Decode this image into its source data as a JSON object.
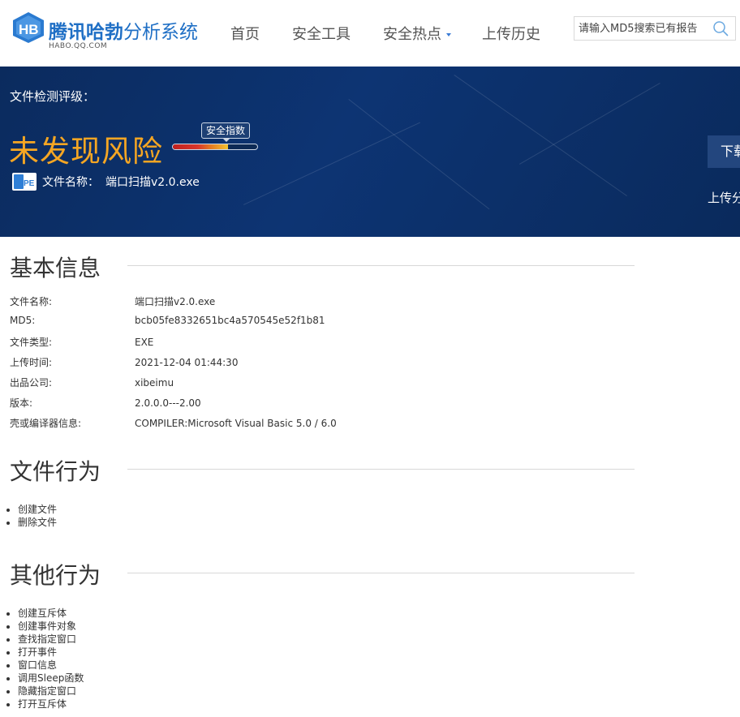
{
  "header": {
    "logo_title_bold": "腾讯哈勃",
    "logo_title_thin": "分析系统",
    "logo_subtitle": "HABO.QQ.COM",
    "nav": [
      {
        "label": "首页"
      },
      {
        "label": "安全工具"
      },
      {
        "label": "安全热点",
        "has_dropdown": true
      },
      {
        "label": "上传历史"
      }
    ],
    "search": {
      "placeholder": "请输入MD5搜索已有报告",
      "value": "",
      "icon": "search-icon"
    }
  },
  "banner": {
    "rating_label": "文件检测评级：",
    "result": "未发现风险",
    "meter_label": "安全指数",
    "meter_level": 0.65,
    "file_icon": "pe-file-icon",
    "file_name_label": "文件名称：",
    "file_name": "端口扫描v2.0.exe",
    "download_label": "下载",
    "upload_share_label": "上传分"
  },
  "basic_info": {
    "title": "基本信息",
    "rows": [
      {
        "key": "文件名称:",
        "value": "端口扫描v2.0.exe"
      },
      {
        "key": "MD5:",
        "value": "bcb05fe8332651bc4a570545e52f1b81"
      },
      {
        "key": "文件类型:",
        "value": "EXE"
      },
      {
        "key": "上传时间:",
        "value": "2021-12-04 01:44:30"
      },
      {
        "key": "出品公司:",
        "value": "xibeimu"
      },
      {
        "key": "版本:",
        "value": "2.0.0.0---2.00"
      },
      {
        "key": "壳或编译器信息:",
        "value": "COMPILER:Microsoft Visual Basic 5.0 / 6.0"
      }
    ]
  },
  "file_behavior": {
    "title": "文件行为",
    "items": [
      "创建文件",
      "删除文件"
    ]
  },
  "other_behavior": {
    "title": "其他行为",
    "items": [
      "创建互斥体",
      "创建事件对象",
      "查找指定窗口",
      "打开事件",
      "窗口信息",
      "调用Sleep函数",
      "隐藏指定窗口",
      "打开互斥体"
    ]
  },
  "colors": {
    "brand": "#1f6fc5",
    "banner_bg": "#0d3473",
    "result": "#f5a623"
  }
}
